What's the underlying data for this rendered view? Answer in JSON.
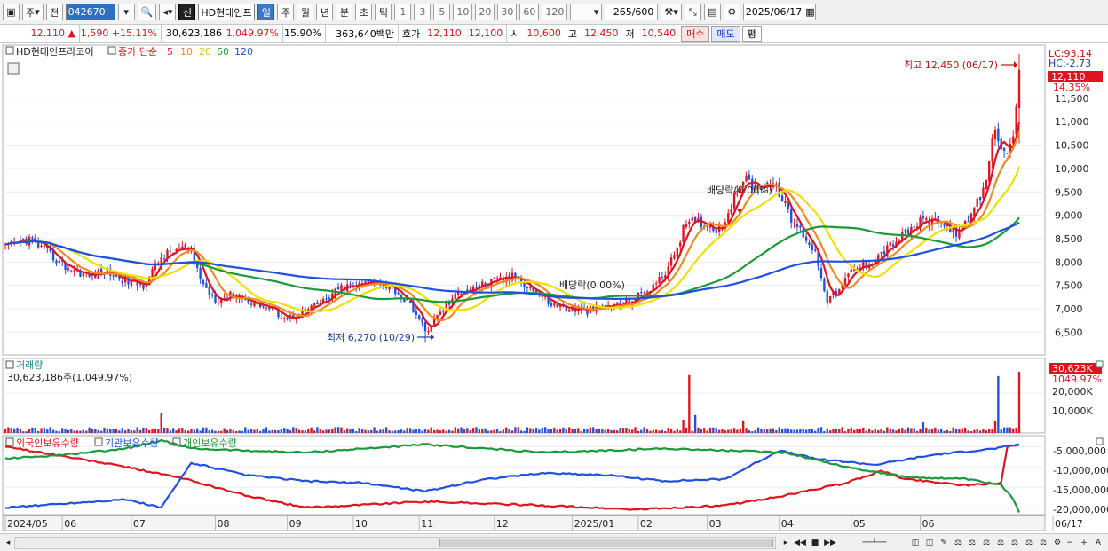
{
  "toolbar": {
    "market": "주",
    "price_mode": "전",
    "code": "042670",
    "name_flag": "신",
    "stock_name": "HD현대인프",
    "periods": [
      "일",
      "주",
      "월",
      "년",
      "분",
      "초",
      "틱"
    ],
    "active_period": "일",
    "intervals": [
      "1",
      "3",
      "5",
      "10",
      "20",
      "30",
      "60",
      "120"
    ],
    "count": "265",
    "count_max": "/600",
    "date": "2025/06/17"
  },
  "quote": {
    "price": "12,110",
    "change_arrow": "▲",
    "change": "1,590",
    "change_pct": "+15.11%",
    "volume": "30,623,186",
    "volume_pct": "1,049.97%",
    "turnover": "15.90%",
    "amount": "363,640백만",
    "quote_label": "호가",
    "ask": "12,110",
    "bid": "12,100",
    "open_label": "시",
    "open": "10,600",
    "high_label": "고",
    "high": "12,450",
    "low_label": "저",
    "low": "10,540",
    "buy_label": "매수",
    "sell_label": "매도",
    "eval_label": "평"
  },
  "legend": {
    "name": "HD현대인프라코어",
    "type": "종가 단순",
    "ma": [
      {
        "label": "5",
        "color": "#e0141e"
      },
      {
        "label": "10",
        "color": "#f08c1e"
      },
      {
        "label": "20",
        "color": "#f0e000"
      },
      {
        "label": "60",
        "color": "#1a9a3a"
      },
      {
        "label": "120",
        "color": "#2050e0"
      }
    ]
  },
  "annotations": {
    "high": "최고 12,450 (06/17)",
    "low": "최저 6,270 (10/29)",
    "dividend1": "배당락(0.00%)",
    "dividend2": "배당락(0.00%)"
  },
  "right_panel": {
    "lc": "LC:93.14",
    "hc": "HC:-2.73",
    "price_tag": "12,110",
    "pct_tag": "14.35%"
  },
  "volume_panel": {
    "title": "거래량",
    "readout": "30,623,186주(1,049.97%)",
    "tag": "30,623K",
    "tag_pct": "1049.97%",
    "ticks": [
      "20,000K",
      "10,000K"
    ]
  },
  "holdings_panel": {
    "legends": [
      {
        "label": "외국인보유수량",
        "color": "#e0141e"
      },
      {
        "label": "기관보유수량",
        "color": "#2050e0"
      },
      {
        "label": "개인보유수량",
        "color": "#1a9a3a"
      }
    ],
    "ticks": [
      "-5,000,000",
      "-10,000,000",
      "-15,000,000",
      "-20,000,000"
    ]
  },
  "x_axis": {
    "labels": [
      "2024/05",
      "06",
      "07",
      "08",
      "09",
      "10",
      "11",
      "12",
      "2025/01",
      "02",
      "03",
      "04",
      "05",
      "06",
      "06/17"
    ]
  },
  "chart_data": {
    "type": "candlestick",
    "y_ticks": [
      12000,
      11500,
      11000,
      10500,
      10000,
      9500,
      9000,
      8500,
      8000,
      7500,
      7000,
      6500
    ],
    "ylim": [
      6050,
      12580
    ],
    "high": {
      "value": 12450,
      "date": "06/17"
    },
    "low": {
      "value": 6270,
      "date": "10/29"
    },
    "last": 12110,
    "close_keypoints": [
      [
        0,
        8300
      ],
      [
        8,
        8500
      ],
      [
        14,
        8200
      ],
      [
        20,
        7900
      ],
      [
        28,
        7700
      ],
      [
        34,
        7800
      ],
      [
        40,
        7600
      ],
      [
        46,
        7500
      ],
      [
        52,
        8100
      ],
      [
        58,
        8300
      ],
      [
        62,
        8200
      ],
      [
        66,
        7500
      ],
      [
        70,
        7200
      ],
      [
        76,
        7300
      ],
      [
        82,
        7150
      ],
      [
        88,
        7000
      ],
      [
        94,
        6800
      ],
      [
        100,
        6950
      ],
      [
        106,
        7150
      ],
      [
        112,
        7450
      ],
      [
        118,
        7500
      ],
      [
        124,
        7600
      ],
      [
        130,
        7400
      ],
      [
        136,
        7000
      ],
      [
        140,
        6500
      ],
      [
        146,
        7000
      ],
      [
        152,
        7400
      ],
      [
        158,
        7500
      ],
      [
        164,
        7600
      ],
      [
        170,
        7700
      ],
      [
        176,
        7400
      ],
      [
        182,
        7100
      ],
      [
        188,
        7000
      ],
      [
        194,
        6950
      ],
      [
        200,
        7050
      ],
      [
        206,
        7100
      ],
      [
        212,
        7300
      ],
      [
        218,
        7600
      ],
      [
        222,
        8000
      ],
      [
        226,
        8700
      ],
      [
        230,
        8900
      ],
      [
        234,
        8800
      ],
      [
        238,
        8700
      ],
      [
        242,
        9200
      ],
      [
        246,
        9800
      ],
      [
        250,
        9600
      ],
      [
        254,
        9700
      ],
      [
        258,
        9500
      ],
      [
        262,
        8900
      ],
      [
        266,
        8600
      ],
      [
        270,
        8200
      ],
      [
        274,
        7200
      ],
      [
        278,
        7400
      ],
      [
        282,
        7800
      ],
      [
        288,
        8000
      ],
      [
        294,
        8300
      ],
      [
        300,
        8600
      ],
      [
        306,
        8900
      ],
      [
        312,
        8800
      ],
      [
        316,
        8700
      ],
      [
        318,
        8600
      ],
      [
        322,
        9000
      ],
      [
        326,
        9500
      ],
      [
        330,
        10900
      ],
      [
        332,
        10500
      ],
      [
        334,
        10200
      ],
      [
        336,
        10600
      ],
      [
        338,
        12110
      ]
    ],
    "volume_ylim": [
      0,
      32000000
    ],
    "holdings_ylim": [
      -21500000,
      -3000000
    ],
    "foreign_keypoints": [
      [
        0,
        -5000000
      ],
      [
        20,
        -7500000
      ],
      [
        40,
        -10000000
      ],
      [
        60,
        -13000000
      ],
      [
        80,
        -17000000
      ],
      [
        100,
        -20000000
      ],
      [
        140,
        -18500000
      ],
      [
        180,
        -19500000
      ],
      [
        210,
        -20500000
      ],
      [
        240,
        -19500000
      ],
      [
        260,
        -17000000
      ],
      [
        280,
        -14000000
      ],
      [
        292,
        -11000000
      ],
      [
        300,
        -13000000
      ],
      [
        320,
        -14500000
      ],
      [
        332,
        -14000000
      ],
      [
        334,
        -5000000
      ],
      [
        338,
        -4500000
      ]
    ],
    "institution_keypoints": [
      [
        0,
        -20000000
      ],
      [
        20,
        -19000000
      ],
      [
        40,
        -18000000
      ],
      [
        52,
        -20000000
      ],
      [
        62,
        -9000000
      ],
      [
        80,
        -12000000
      ],
      [
        100,
        -13500000
      ],
      [
        120,
        -14000000
      ],
      [
        140,
        -16000000
      ],
      [
        160,
        -13000000
      ],
      [
        180,
        -11500000
      ],
      [
        200,
        -12000000
      ],
      [
        220,
        -13500000
      ],
      [
        240,
        -13000000
      ],
      [
        258,
        -6000000
      ],
      [
        270,
        -8000000
      ],
      [
        290,
        -9500000
      ],
      [
        310,
        -7000000
      ],
      [
        330,
        -5500000
      ],
      [
        338,
        -4500000
      ]
    ],
    "individual_keypoints": [
      [
        0,
        -8000000
      ],
      [
        20,
        -7000000
      ],
      [
        40,
        -5500000
      ],
      [
        52,
        -3500000
      ],
      [
        62,
        -5500000
      ],
      [
        80,
        -6000000
      ],
      [
        100,
        -6500000
      ],
      [
        120,
        -5500000
      ],
      [
        140,
        -4500000
      ],
      [
        160,
        -5500000
      ],
      [
        180,
        -6500000
      ],
      [
        200,
        -6000000
      ],
      [
        220,
        -5500000
      ],
      [
        240,
        -6000000
      ],
      [
        260,
        -6500000
      ],
      [
        280,
        -10000000
      ],
      [
        300,
        -12500000
      ],
      [
        320,
        -13000000
      ],
      [
        332,
        -14500000
      ],
      [
        336,
        -18000000
      ],
      [
        338,
        -21000000
      ]
    ]
  }
}
